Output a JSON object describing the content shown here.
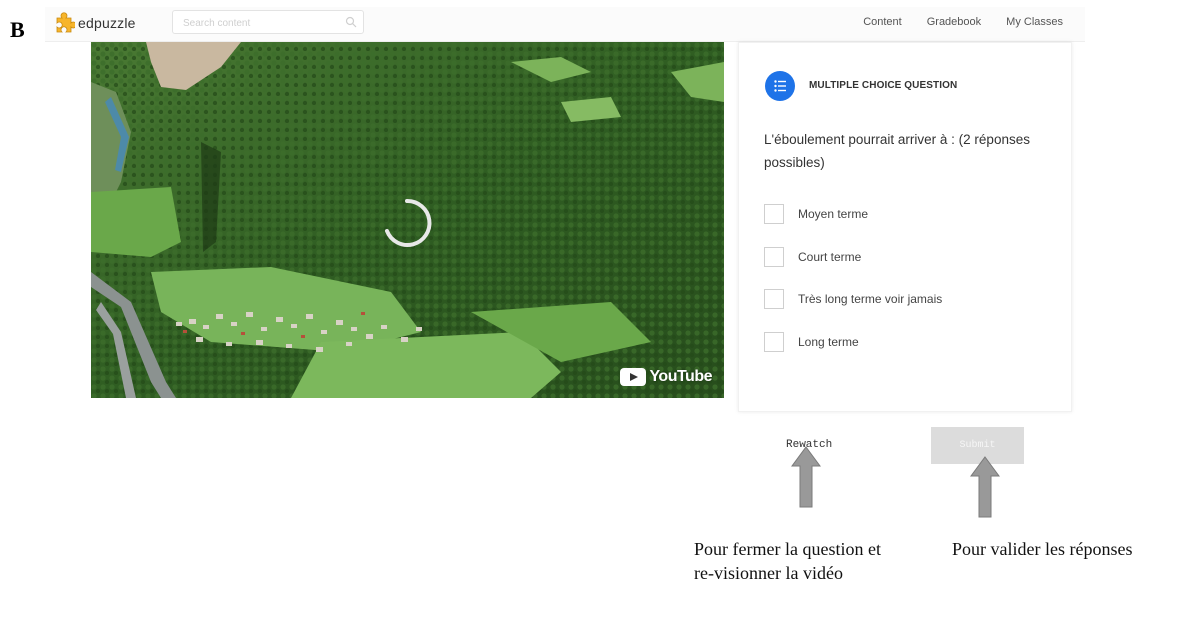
{
  "panel_letter": "B",
  "app": {
    "logo_text": "edpuzzle",
    "search_placeholder": "Search content",
    "nav": [
      "Content",
      "Gradebook",
      "My Classes"
    ]
  },
  "video": {
    "overlay_brand": "YouTube",
    "loading": true
  },
  "question": {
    "type_label": "MULTIPLE CHOICE QUESTION",
    "text": "L'éboulement pourrait arriver à : (2 réponses possibles)",
    "options": [
      "Moyen terme",
      "Court terme",
      "Très long terme voir jamais",
      "Long terme"
    ]
  },
  "actions": {
    "rewatch_label": "Rewatch",
    "submit_label": "Submit"
  },
  "annotations": {
    "rewatch_note": "Pour fermer la question et re-visionner la vidéo",
    "submit_note": "Pour valider les réponses"
  },
  "colors": {
    "accent": "#1e73e8",
    "submit_disabled": "#dcdcdc",
    "arrow": "#999999"
  }
}
